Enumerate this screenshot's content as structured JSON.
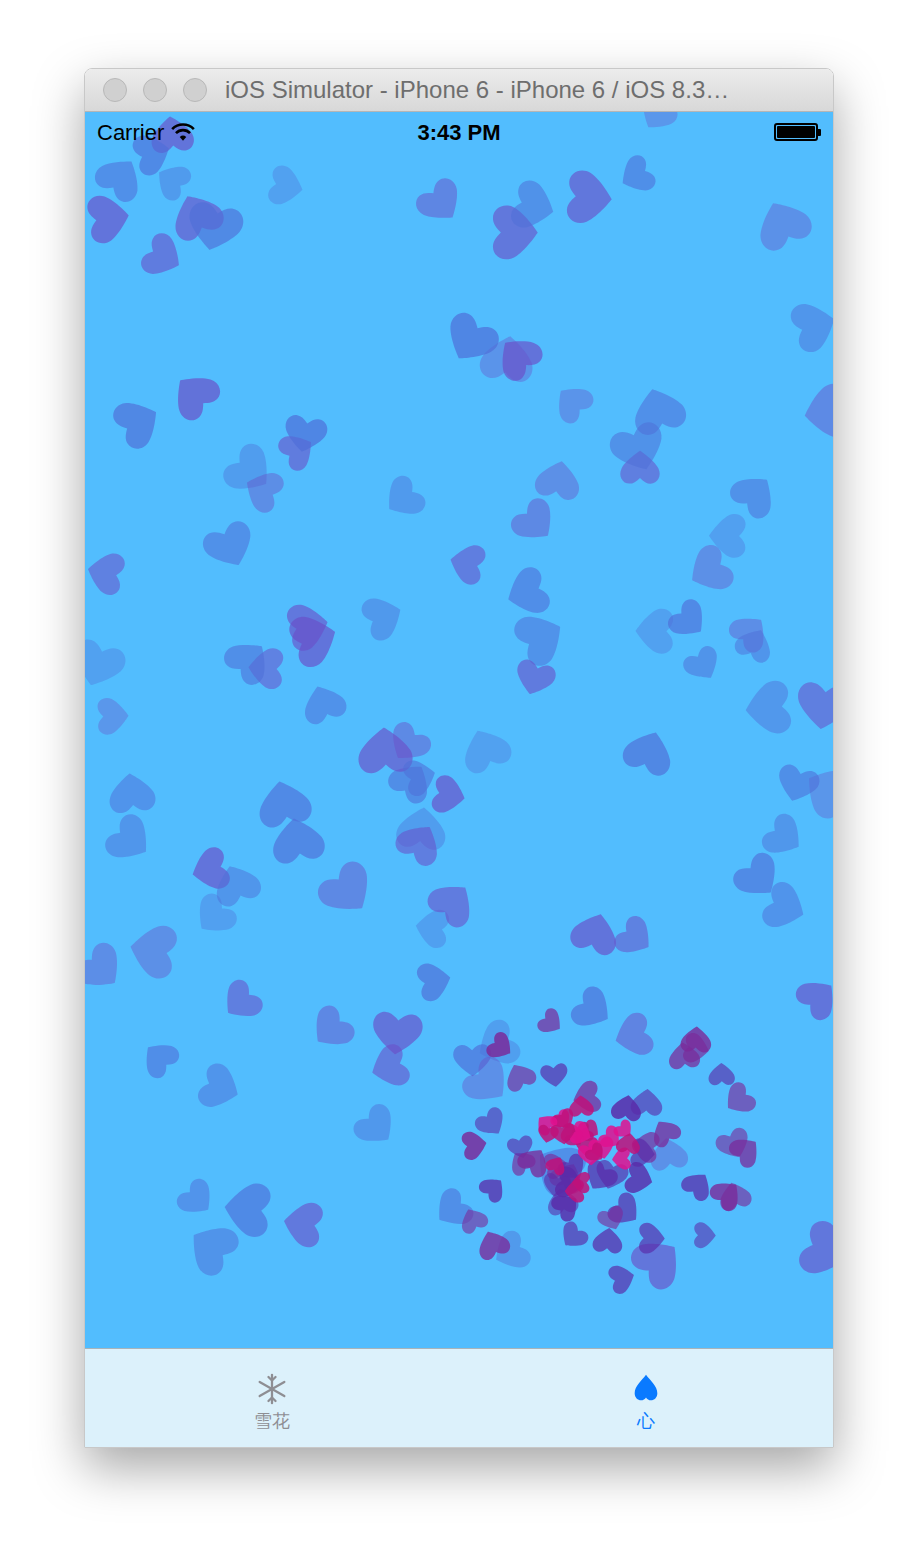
{
  "window": {
    "title": "iOS Simulator - iPhone 6 - iPhone 6 / iOS 8.3…"
  },
  "status_bar": {
    "carrier": "Carrier",
    "time": "3:43 PM",
    "battery_level": 1
  },
  "tabs": [
    {
      "label": "雪花",
      "selected": false
    },
    {
      "label": "心",
      "selected": true
    }
  ]
}
